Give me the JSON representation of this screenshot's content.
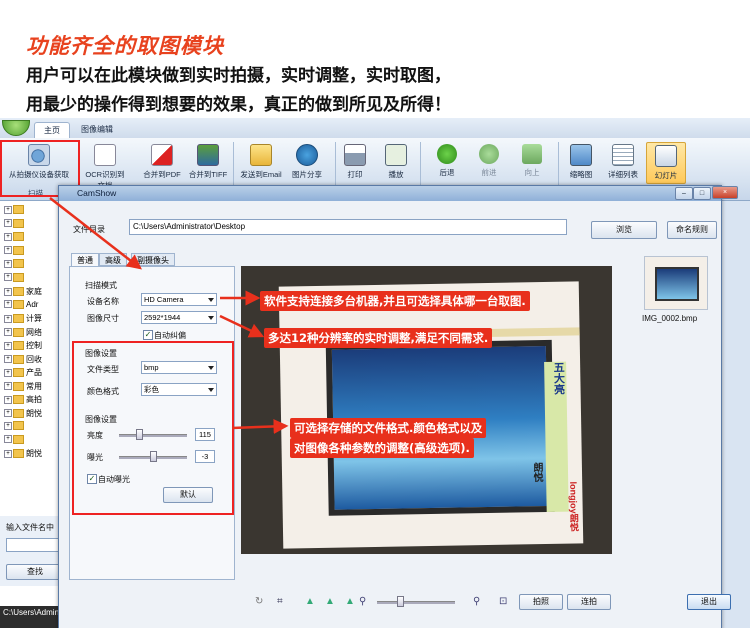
{
  "promo": {
    "title": "功能齐全的取图模块",
    "line1": "用户可以在此模块做到实时拍摄，实时调整，实时取图，",
    "line2": "用最少的操作得到想要的效果，真正的做到所见及所得！"
  },
  "tabs": [
    {
      "label": "主页"
    },
    {
      "label": "图像编辑"
    }
  ],
  "ribbon": {
    "buttons": [
      {
        "label": "从拍摄仪设备获取",
        "icon": "camera-icon"
      },
      {
        "label": "OCR识别到文档",
        "icon": "ocr-icon"
      },
      {
        "label": "合并到PDF",
        "icon": "pdf-icon"
      },
      {
        "label": "合并到TIFF",
        "icon": "tiff-icon"
      },
      {
        "label": "发送到Email",
        "icon": "email-icon"
      },
      {
        "label": "图片分享",
        "icon": "share-icon"
      },
      {
        "label": "打印",
        "icon": "print-icon"
      },
      {
        "label": "播放",
        "icon": "play-icon"
      },
      {
        "label": "后退",
        "icon": "back-icon"
      },
      {
        "label": "前进",
        "icon": "forward-icon"
      },
      {
        "label": "向上",
        "icon": "up-icon"
      },
      {
        "label": "缩略图",
        "icon": "thumbnail-icon"
      },
      {
        "label": "详细列表",
        "icon": "list-icon"
      },
      {
        "label": "幻灯片",
        "icon": "slideshow-icon"
      }
    ],
    "group_label": "扫描"
  },
  "tree": {
    "items": [
      "",
      "",
      "",
      "",
      "",
      "",
      "家庭",
      "Adr",
      "计算",
      "网络",
      "控制",
      "回收",
      "产品",
      "常用",
      "高拍",
      "朗悦",
      "",
      "",
      "朗悦"
    ]
  },
  "left_bottom": {
    "input_label": "输入文件名中",
    "search_button": "查找",
    "status": "C:\\Users\\Admin"
  },
  "dialog": {
    "title": "CamShow",
    "folder_label": "文件目录",
    "folder_path": "C:\\Users\\Administrator\\Desktop",
    "browse_button": "浏览",
    "naming_button": "命名规则",
    "tabs": [
      "普通",
      "高级",
      "副摄像头"
    ],
    "scan_mode_label": "扫描模式",
    "device_label": "设备名称",
    "device_value": "HD Camera",
    "size_label": "图像尺寸",
    "size_value": "2592*1944",
    "autocorrect_label": "自动纠偏",
    "image_settings_label": "图像设置",
    "filetype_label": "文件类型",
    "filetype_value": "bmp",
    "colorformat_label": "颜色格式",
    "colorformat_value": "彩色",
    "image_adjust_label": "图像设置",
    "brightness_label": "亮度",
    "brightness_value": "115",
    "exposure_label": "曝光",
    "exposure_value": "-3",
    "autoexposure_label": "自动曝光",
    "default_button": "默认",
    "thumbnail_name": "IMG_0002.bmp",
    "capture_button": "拍照",
    "continuous_button": "连拍",
    "exit_button": "退出",
    "brightness_level": 0.3,
    "exposure_level": 0.5,
    "zoom_level": 0.3
  },
  "callouts": {
    "c1": "软件支持连接多台机器,并且可选择具体哪一台取图.",
    "c2": "多达12种分辨率的实时调整,满足不同需求.",
    "c3_line1": "可选择存储的文件格式.颜色格式以及",
    "c3_line2": "对图像各种参数的调整(高级选项)."
  },
  "preview_text": {
    "vertical1": "朗悦",
    "vertical2": "五大亮",
    "brand": "longjoy朗悦"
  },
  "colors": {
    "accent_red": "#e8301c",
    "title_orange": "#e8421e"
  }
}
